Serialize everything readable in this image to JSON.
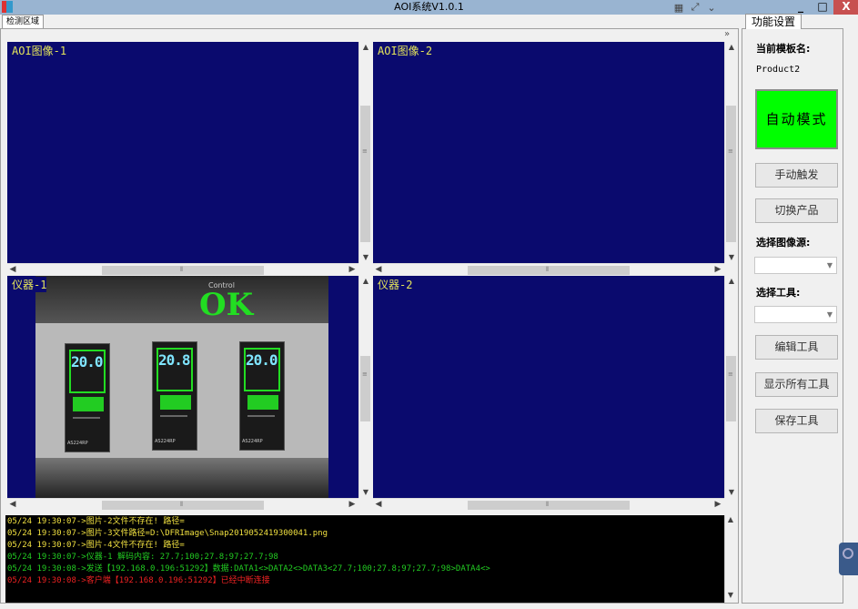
{
  "window": {
    "title": "AOI系统V1.0.1",
    "minimize": "_",
    "maximize": "□",
    "close": "X"
  },
  "ribbon_controls": [
    "grid-icon",
    "expand-icon",
    "chevron-down-icon"
  ],
  "left_tab": {
    "label": "检测区域"
  },
  "panes": [
    {
      "label": "AOI图像-1"
    },
    {
      "label": "AOI图像-2"
    },
    {
      "label": "仪器-1"
    },
    {
      "label": "仪器-2"
    }
  ],
  "inspection": {
    "result": "OK",
    "overlay_text": "Control",
    "meters": [
      {
        "reading": "20.0",
        "model": "AS224RP"
      },
      {
        "reading": "20.8",
        "model": "AS224RP"
      },
      {
        "reading": "20.0",
        "model": "AS224RP"
      }
    ]
  },
  "log": [
    {
      "text": "05/24 19:30:07->图片-2文件不存在! 路径=",
      "color": "#f0e040"
    },
    {
      "text": "05/24 19:30:07->图片-3文件路径=D:\\DFRImage\\Snap2019052419300041.png",
      "color": "#f0e040"
    },
    {
      "text": "05/24 19:30:07->图片-4文件不存在! 路径=",
      "color": "#f0e040"
    },
    {
      "text": "05/24 19:30:07->仪器-1 解码内容: 27.7;100;27.8;97;27.7;98",
      "color": "#22cc22"
    },
    {
      "text": "05/24 19:30:08->发送【192.168.0.196:51292】数据:DATA1<>DATA2<>DATA3<27.7;100;27.8;97;27.7;98>DATA4<>",
      "color": "#22cc22"
    },
    {
      "text": "05/24 19:30:08->客户端【192.168.0.196:51292】已经中断连接",
      "color": "#ee2222"
    }
  ],
  "right_panel": {
    "tab": "功能设置",
    "template_label": "当前模板名:",
    "template_name": "Product2",
    "auto_mode": "自动模式",
    "manual_trigger": "手动触发",
    "switch_product": "切换产品",
    "image_source_label": "选择图像源:",
    "image_source_value": "",
    "tool_label": "选择工具:",
    "tool_value": "",
    "edit_tool": "编辑工具",
    "show_all_tools": "显示所有工具",
    "save_tool": "保存工具"
  },
  "colors": {
    "pane_bg": "#0a0a6e",
    "pane_label": "#e6e65a",
    "auto_mode_bg": "#00ff00",
    "titlebar": "#99b4d1",
    "close": "#c75050"
  }
}
